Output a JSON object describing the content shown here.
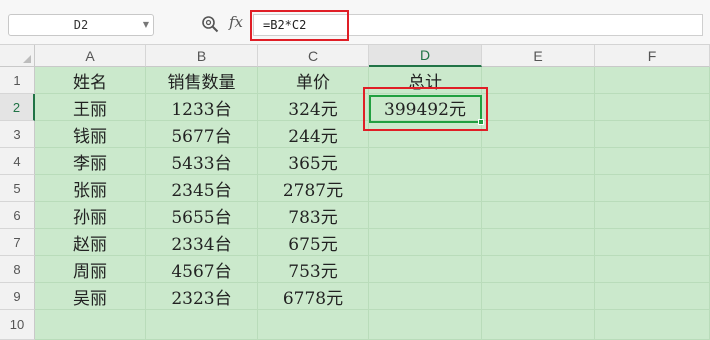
{
  "formula_bar": {
    "name_box": "D2",
    "fx_label": "fx",
    "formula": "=B2*C2"
  },
  "columns": [
    "A",
    "B",
    "C",
    "D",
    "E",
    "F"
  ],
  "rows": [
    "1",
    "2",
    "3",
    "4",
    "5",
    "6",
    "7",
    "8",
    "9",
    "10"
  ],
  "active_cell": "D2",
  "sheet": {
    "header": [
      "姓名",
      "销售数量",
      "单价",
      "总计"
    ],
    "data": [
      [
        "王丽",
        "1233台",
        "324元",
        "399492元"
      ],
      [
        "钱丽",
        "5677台",
        "244元",
        ""
      ],
      [
        "李丽",
        "5433台",
        "365元",
        ""
      ],
      [
        "张丽",
        "2345台",
        "2787元",
        ""
      ],
      [
        "孙丽",
        "5655台",
        "783元",
        ""
      ],
      [
        "赵丽",
        "2334台",
        "675元",
        ""
      ],
      [
        "周丽",
        "4567台",
        "753元",
        ""
      ],
      [
        "吴丽",
        "2323台",
        "6778元",
        ""
      ]
    ]
  },
  "colors": {
    "cell_fill": "#cbe9cc",
    "selection": "#21a040",
    "highlight": "#e01e26"
  }
}
